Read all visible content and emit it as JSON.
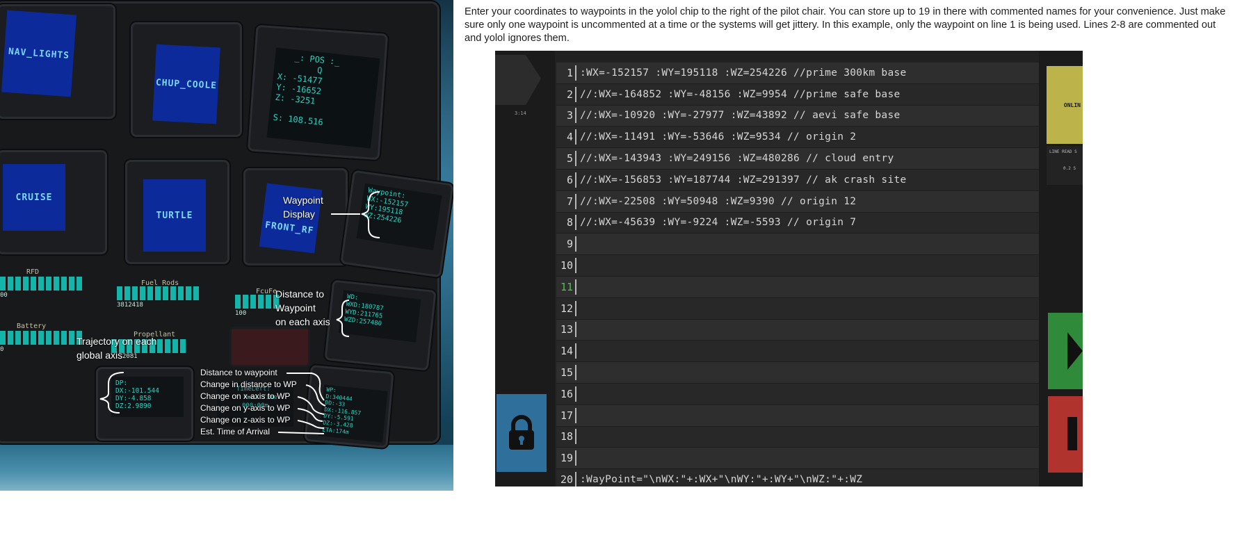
{
  "intro": {
    "text": "Enter your coordinates to waypoints in the yolol chip to the right of the pilot chair.  You can store up to 19 in there with commented names for your convenience.  Just make sure only one waypoint is uncommented at a time or the systems will get jittery.  In this example, only the waypoint on line 1 is being used.  Lines 2-8 are commented out and yolol ignores them."
  },
  "game": {
    "buttons": {
      "nav_lights": "NAV_LIGHTS",
      "chup_coole": "CHUP_COOLE",
      "cruise": "CRUISE",
      "turtle": "TURTLE",
      "front_rf": "FRONT_RF"
    },
    "pos_screen": {
      "title": "_:  POS  :_",
      "title2": "Q",
      "x": "X: -51477",
      "y": "Y: -16652",
      "z": "Z: -3251",
      "s": "S: 108.516"
    },
    "gauges": {
      "rfd": "RFD",
      "fuel_rods": "Fuel_Rods",
      "fuel_rods_value": "3812418",
      "fcufe": "FcuFe",
      "fcufe_value": "100",
      "battery": "Battery",
      "propellant": "Propellant",
      "propellant_value": "2081",
      "left_value1": "00",
      "left_value2": "0"
    },
    "waypoint_screen": [
      "Waypoint:",
      "WX:-152157",
      "WY:195118",
      "WZ:254226"
    ],
    "wd_screen": [
      "WD:",
      "WXD:180787",
      "WYD:211765",
      "WZD:257480"
    ],
    "dp_screen": [
      "DP:",
      "DX:-101.544",
      "DY:-4.858",
      "DZ:2.9890"
    ],
    "wp_screen": [
      "WP:",
      "D:340444",
      "DD:-33",
      "DX:-116.857",
      "DY:-5.591",
      "DZ:-3.428",
      "ETA:174m"
    ],
    "time_screen": [
      "TimeLeft:",
      "Fuel Time",
      "000:00m"
    ]
  },
  "annotations": {
    "waypoint_display": [
      "Waypoint",
      "Display"
    ],
    "distance_axis": [
      "Distance to",
      "Waypoint",
      "on each axis"
    ],
    "trajectory": [
      "Trajectory on each",
      "global axis"
    ],
    "legend": [
      "Distance to waypoint",
      "Change in distance to WP",
      "Change on x-axis to WP",
      "Change on y-axis to WP",
      "Change on z-axis to WP",
      "Est. Time of Arrival"
    ]
  },
  "editor": {
    "active_line": 11,
    "lines": [
      {
        "n": "1",
        "code": ":WX=-152157 :WY=195118 :WZ=254226 //prime 300km base"
      },
      {
        "n": "2",
        "code": "//:WX=-164852 :WY=-48156 :WZ=9954 //prime safe base"
      },
      {
        "n": "3",
        "code": "//:WX=-10920 :WY=-27977 :WZ=43892 // aevi safe base"
      },
      {
        "n": "4",
        "code": "//:WX=-11491 :WY=-53646 :WZ=9534 // origin 2"
      },
      {
        "n": "5",
        "code": "//:WX=-143943 :WY=249156 :WZ=480286 // cloud entry"
      },
      {
        "n": "6",
        "code": "//:WX=-156853 :WY=187744 :WZ=291397 // ak crash site"
      },
      {
        "n": "7",
        "code": "//:WX=-22508 :WY=50948 :WZ=9390 // origin 12"
      },
      {
        "n": "8",
        "code": "//:WX=-45639 :WY=-9224 :WZ=-5593 // origin 7"
      },
      {
        "n": "9",
        "code": ""
      },
      {
        "n": "10",
        "code": ""
      },
      {
        "n": "11",
        "code": ""
      },
      {
        "n": "12",
        "code": ""
      },
      {
        "n": "13",
        "code": ""
      },
      {
        "n": "14",
        "code": ""
      },
      {
        "n": "15",
        "code": ""
      },
      {
        "n": "16",
        "code": ""
      },
      {
        "n": "17",
        "code": ""
      },
      {
        "n": "18",
        "code": ""
      },
      {
        "n": "19",
        "code": ""
      },
      {
        "n": "20",
        "code": ":WayPoint=\"\\nWX:\"+:WX+\"\\nWY:\"+:WY+\"\\nWZ:\"+:WZ"
      }
    ],
    "side_label": "3:14",
    "online_label": "ONLIN",
    "line_read_label": "LINE READ S",
    "line_read_value": "0.2 S"
  },
  "colors": {
    "accent_teal": "#13b5aa",
    "screen_blue": "#0d2a9a",
    "lock_blue": "#2e6f9c",
    "online_yellow": "#bcb44a",
    "run_green": "#2f8a3a",
    "stop_red": "#b0332e"
  }
}
